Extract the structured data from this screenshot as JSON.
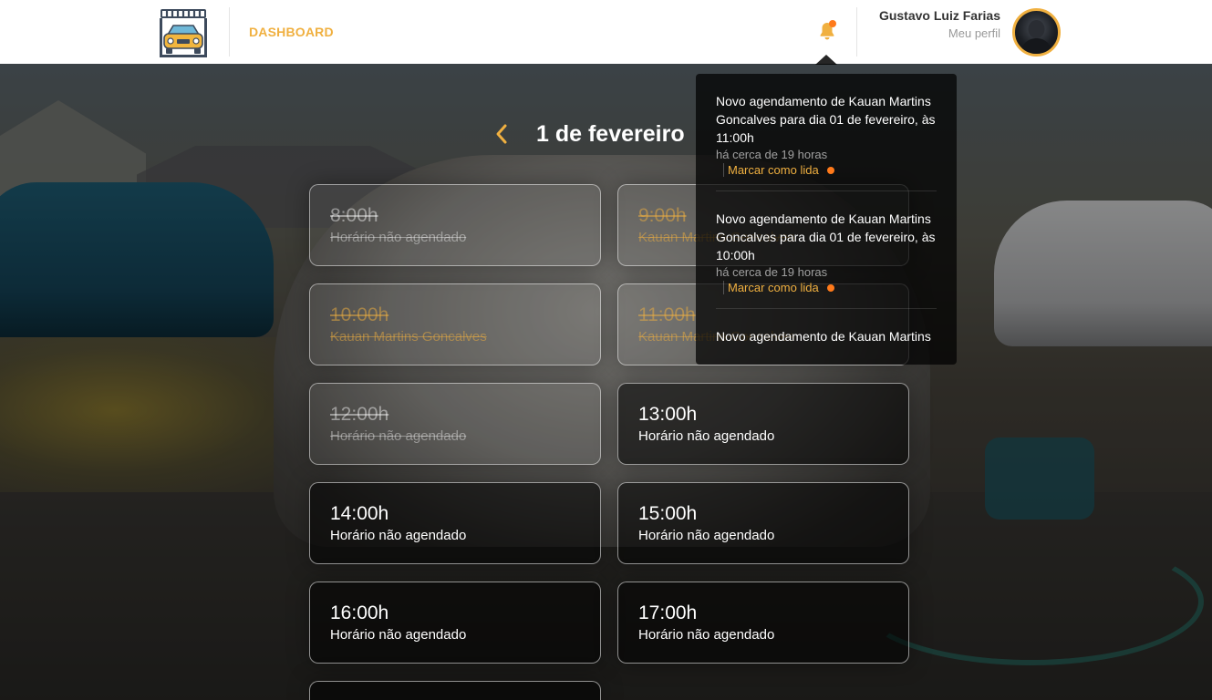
{
  "header": {
    "nav_label": "DASHBOARD",
    "user_name": "Gustavo Luiz Farias",
    "profile_link": "Meu perfil",
    "accent_color": "#f0b040",
    "notification_dot_color": "#ff7a1a"
  },
  "icons": {
    "logo": "car-wash-logo-icon",
    "bell": "bell-icon",
    "prev": "chevron-left-icon"
  },
  "schedule": {
    "date_title": "1 de fevereiro",
    "slots": [
      {
        "time": "8:00h",
        "status": "Horário não agendado",
        "past": true,
        "booked": false
      },
      {
        "time": "9:00h",
        "status": "Kauan Martins Goncalves",
        "past": true,
        "booked": true
      },
      {
        "time": "10:00h",
        "status": "Kauan Martins Goncalves",
        "past": true,
        "booked": true
      },
      {
        "time": "11:00h",
        "status": "Kauan Martins Goncalves",
        "past": true,
        "booked": true
      },
      {
        "time": "12:00h",
        "status": "Horário não agendado",
        "past": true,
        "booked": false
      },
      {
        "time": "13:00h",
        "status": "Horário não agendado",
        "past": false,
        "booked": false
      },
      {
        "time": "14:00h",
        "status": "Horário não agendado",
        "past": false,
        "booked": false
      },
      {
        "time": "15:00h",
        "status": "Horário não agendado",
        "past": false,
        "booked": false
      },
      {
        "time": "16:00h",
        "status": "Horário não agendado",
        "past": false,
        "booked": false
      },
      {
        "time": "17:00h",
        "status": "Horário não agendado",
        "past": false,
        "booked": false
      }
    ]
  },
  "notifications": [
    {
      "text": "Novo agendamento de Kauan Martins Goncalves para dia 01 de fevereiro, às 11:00h",
      "time": "há cerca de 19 horas",
      "action": "Marcar como lida"
    },
    {
      "text": "Novo agendamento de Kauan Martins Goncalves para dia 01 de fevereiro, às 10:00h",
      "time": "há cerca de 19 horas",
      "action": "Marcar como lida"
    },
    {
      "text": "Novo agendamento de Kauan Martins",
      "time": "",
      "action": ""
    }
  ]
}
